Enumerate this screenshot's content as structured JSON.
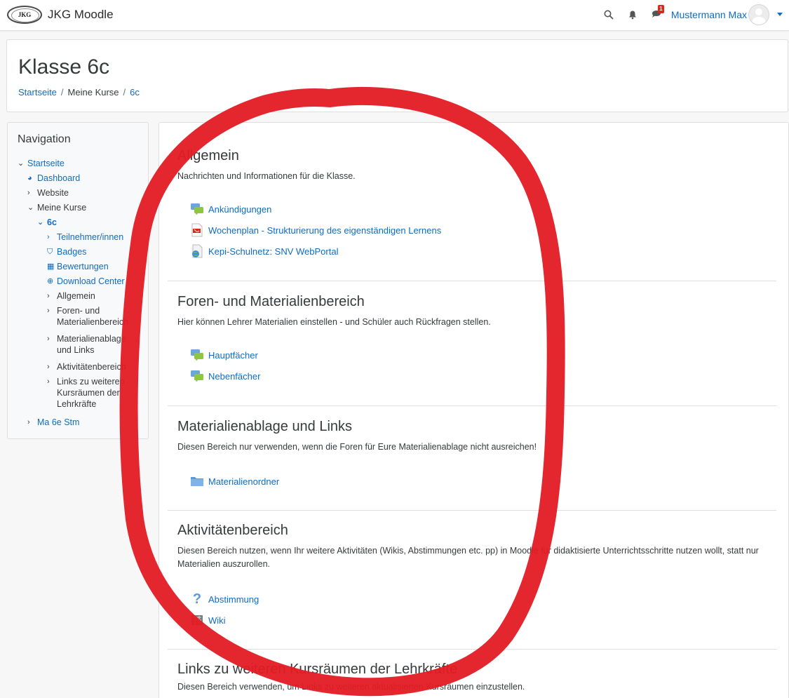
{
  "navbar": {
    "logo_text": "JKG",
    "site_name": "JKG Moodle",
    "message_badge": "1",
    "user_name": "Mustermann Max"
  },
  "header": {
    "title": "Klasse 6c",
    "breadcrumb": [
      "Startseite",
      "Meine Kurse",
      "6c"
    ]
  },
  "navigation": {
    "title": "Navigation",
    "items": [
      {
        "label": "Startseite"
      },
      {
        "label": "Dashboard"
      },
      {
        "label": "Website"
      },
      {
        "label": "Meine Kurse"
      },
      {
        "label": "6c"
      },
      {
        "label": "Teilnehmer/innen"
      },
      {
        "label": "Badges"
      },
      {
        "label": "Bewertungen"
      },
      {
        "label": "Download Center"
      },
      {
        "label": "Allgemein"
      },
      {
        "label": "Foren- und Materialienbereich"
      },
      {
        "label": "Materialienablage und Links"
      },
      {
        "label": "Aktivitätenbereich"
      },
      {
        "label": "Links zu weiteren Kursräumen der Lehrkräfte"
      },
      {
        "label": "Ma 6e Stm"
      }
    ]
  },
  "sections": [
    {
      "title": "Allgemein",
      "summary": "Nachrichten und Informationen für die Klasse.",
      "activities": [
        {
          "label": "Ankündigungen",
          "icon": "forum-icon"
        },
        {
          "label": "Wochenplan - Strukturierung des eigenständigen Lernens",
          "icon": "pdf-icon"
        },
        {
          "label": "Kepi-Schulnetz: SNV WebPortal",
          "icon": "url-icon"
        }
      ]
    },
    {
      "title": "Foren- und Materialienbereich",
      "summary": "Hier können Lehrer Materialien einstellen - und Schüler auch Rückfragen stellen.",
      "activities": [
        {
          "label": "Hauptfächer",
          "icon": "forum-icon"
        },
        {
          "label": "Nebenfächer",
          "icon": "forum-icon"
        }
      ]
    },
    {
      "title": "Materialienablage und Links",
      "summary": "Diesen Bereich nur verwenden, wenn die Foren für Eure Materialienablage nicht ausreichen!",
      "activities": [
        {
          "label": "Materialienordner",
          "icon": "folder-icon"
        }
      ]
    },
    {
      "title": "Aktivitätenbereich",
      "summary": "Diesen Bereich nutzen, wenn Ihr weitere Aktivitäten (Wikis, Abstimmungen etc. pp) in Moodle für didaktisierte Unterrichtsschritte nutzen wollt, statt nur Materialien auszurollen.",
      "activities": [
        {
          "label": "Abstimmung",
          "icon": "choice-icon"
        },
        {
          "label": "Wiki",
          "icon": "wiki-icon"
        }
      ]
    },
    {
      "title": "Links zu weiteren Kursräumen der Lehrkräfte",
      "summary": "Diesen Bereich verwenden, um Links zu weiteren aktualisierten Kursräumen einzustellen."
    }
  ],
  "colors": {
    "link": "#0f6cbf",
    "annotation": "#e31b23"
  }
}
